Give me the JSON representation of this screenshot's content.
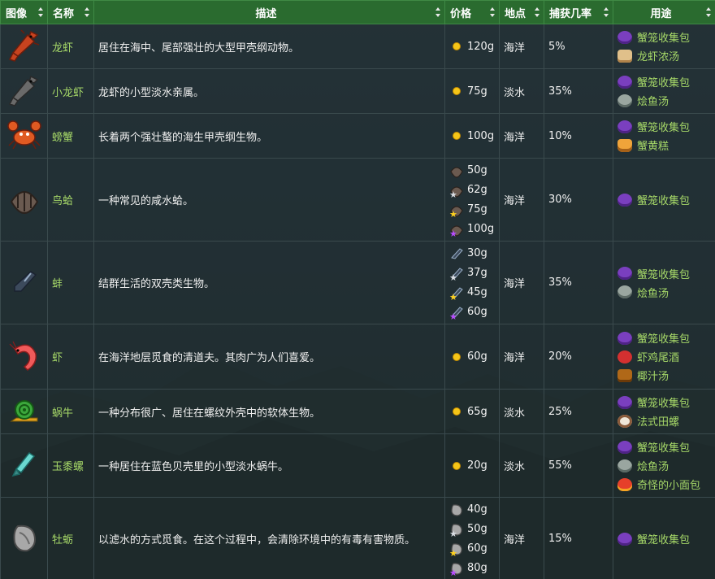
{
  "headers": {
    "image": "图像",
    "name": "名称",
    "description": "描述",
    "price": "价格",
    "location": "地点",
    "chance": "捕获几率",
    "uses": "用途"
  },
  "items": [
    {
      "key": "lobster",
      "name": "龙虾",
      "desc": "居住在海中、尾部强壮的大型甲壳纲动物。",
      "prices": [
        {
          "q": "base",
          "v": "120g"
        }
      ],
      "location": "海洋",
      "chance": "5%",
      "uses": [
        {
          "icon": "crab-pot-icon",
          "label": "蟹笼收集包"
        },
        {
          "icon": "lobster-bisque-icon",
          "label": "龙虾浓汤"
        }
      ]
    },
    {
      "key": "crayfish",
      "name": "小龙虾",
      "desc": "龙虾的小型淡水亲属。",
      "prices": [
        {
          "q": "base",
          "v": "75g"
        }
      ],
      "location": "淡水",
      "chance": "35%",
      "uses": [
        {
          "icon": "crab-pot-icon",
          "label": "蟹笼收集包"
        },
        {
          "icon": "fish-stew-icon",
          "label": "烩鱼汤"
        }
      ]
    },
    {
      "key": "crab",
      "name": "螃蟹",
      "desc": "长着两个强壮螯的海生甲壳纲生物。",
      "prices": [
        {
          "q": "base",
          "v": "100g"
        }
      ],
      "location": "海洋",
      "chance": "10%",
      "uses": [
        {
          "icon": "crab-pot-icon",
          "label": "蟹笼收集包"
        },
        {
          "icon": "crab-cakes-icon",
          "label": "蟹黄糕"
        }
      ]
    },
    {
      "key": "cockle",
      "name": "鸟蛤",
      "desc": "一种常见的咸水蛤。",
      "prices": [
        {
          "q": "base",
          "v": "50g"
        },
        {
          "q": "silver",
          "v": "62g"
        },
        {
          "q": "gold",
          "v": "75g"
        },
        {
          "q": "iridium",
          "v": "100g"
        }
      ],
      "location": "海洋",
      "chance": "30%",
      "uses": [
        {
          "icon": "crab-pot-icon",
          "label": "蟹笼收集包"
        }
      ]
    },
    {
      "key": "mussel",
      "name": "蚌",
      "desc": "结群生活的双壳类生物。",
      "prices": [
        {
          "q": "base",
          "v": "30g"
        },
        {
          "q": "silver",
          "v": "37g"
        },
        {
          "q": "gold",
          "v": "45g"
        },
        {
          "q": "iridium",
          "v": "60g"
        }
      ],
      "location": "海洋",
      "chance": "35%",
      "uses": [
        {
          "icon": "crab-pot-icon",
          "label": "蟹笼收集包"
        },
        {
          "icon": "fish-stew-icon",
          "label": "烩鱼汤"
        }
      ]
    },
    {
      "key": "shrimp",
      "name": "虾",
      "desc": "在海洋地层觅食的清道夫。其肉广为人们喜爱。",
      "prices": [
        {
          "q": "base",
          "v": "60g"
        }
      ],
      "location": "海洋",
      "chance": "20%",
      "uses": [
        {
          "icon": "crab-pot-icon",
          "label": "蟹笼收集包"
        },
        {
          "icon": "shrimp-cocktail-icon",
          "label": "虾鸡尾酒"
        },
        {
          "icon": "coconut-soup-icon",
          "label": "椰汁汤"
        }
      ]
    },
    {
      "key": "snail",
      "name": "蜗牛",
      "desc": "一种分布很广、居住在螺纹外壳中的软体生物。",
      "prices": [
        {
          "q": "base",
          "v": "65g"
        }
      ],
      "location": "淡水",
      "chance": "25%",
      "uses": [
        {
          "icon": "crab-pot-icon",
          "label": "蟹笼收集包"
        },
        {
          "icon": "escargot-icon",
          "label": "法式田螺"
        }
      ]
    },
    {
      "key": "periwinkle",
      "name": "玉黍螺",
      "desc": "一种居住在蓝色贝壳里的小型淡水蜗牛。",
      "prices": [
        {
          "q": "base",
          "v": "20g"
        }
      ],
      "location": "淡水",
      "chance": "55%",
      "uses": [
        {
          "icon": "crab-pot-icon",
          "label": "蟹笼收集包"
        },
        {
          "icon": "fish-stew-icon",
          "label": "烩鱼汤"
        },
        {
          "icon": "strange-bun-icon",
          "label": "奇怪的小面包"
        }
      ]
    },
    {
      "key": "oyster",
      "name": "牡蛎",
      "desc": "以滤水的方式觅食。在这个过程中，会清除环境中的有毒有害物质。",
      "prices": [
        {
          "q": "base",
          "v": "40g"
        },
        {
          "q": "silver",
          "v": "50g"
        },
        {
          "q": "gold",
          "v": "60g"
        },
        {
          "q": "iridium",
          "v": "80g"
        }
      ],
      "location": "海洋",
      "chance": "15%",
      "uses": [
        {
          "icon": "crab-pot-icon",
          "label": "蟹笼收集包"
        }
      ]
    }
  ],
  "colors": {
    "header_bg": "#2a6b2f",
    "name_text": "#a6d868",
    "coin": "#f5c518",
    "silver_star": "#d9dde3",
    "gold_star": "#ffd21f",
    "iridium_star": "#b84dff"
  }
}
